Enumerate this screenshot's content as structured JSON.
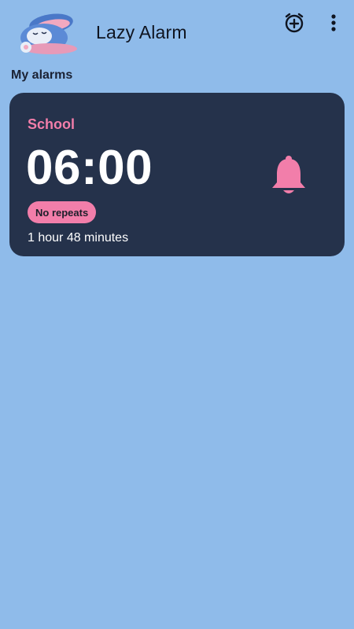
{
  "app": {
    "title": "Lazy Alarm",
    "background_color": "#8fbbea"
  },
  "header": {
    "logo": "bunny-mascot-logo",
    "actions": [
      {
        "icon": "add-alarm-icon"
      },
      {
        "icon": "more-vertical-icon"
      }
    ]
  },
  "section": {
    "label": "My alarms"
  },
  "alarms": [
    {
      "name": "School",
      "time": "06:00",
      "repeat": "No repeats",
      "time_remaining": "1 hour 48 minutes",
      "enabled_icon": "bell-icon",
      "card_color": "#25324b",
      "accent_color": "#f27eaa"
    }
  ]
}
